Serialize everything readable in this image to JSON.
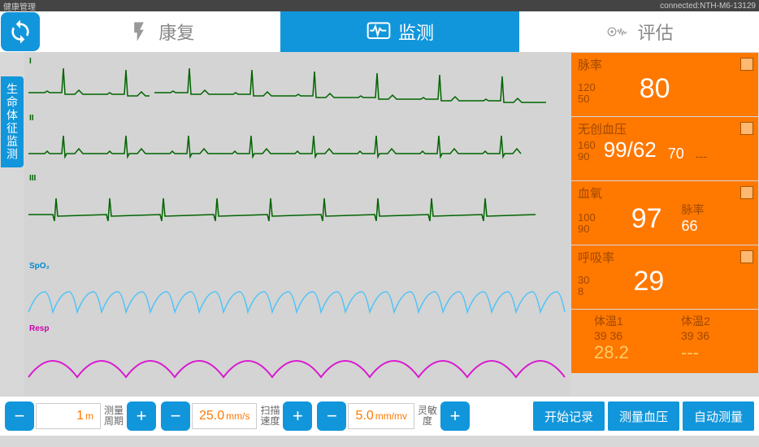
{
  "topbar": {
    "title": "健康管理",
    "status": "connected:NTH-M6-13129"
  },
  "tabs": {
    "rehab": "康复",
    "monitor": "监测",
    "assess": "评估"
  },
  "sidebar": {
    "label": "生命体征监测"
  },
  "waves": {
    "lead1": "I",
    "lead2": "II",
    "lead3": "III",
    "spo2": "SpO₂",
    "resp": "Resp"
  },
  "vitals": {
    "pulse": {
      "title": "脉率",
      "hi": "120",
      "lo": "50",
      "val": "80"
    },
    "nibp": {
      "title": "无创血压",
      "hi": "160",
      "lo": "90",
      "val": "99/62",
      "sub": "70",
      "sub2": "---"
    },
    "spo2": {
      "title": "血氧",
      "hi": "100",
      "lo": "90",
      "val": "97",
      "sublabel": "脉率",
      "subval": "66"
    },
    "resp": {
      "title": "呼吸率",
      "hi": "30",
      "lo": "8",
      "val": "29"
    },
    "temp": {
      "t1label": "体温1",
      "t1limits": "39 36",
      "t1val": "28.2",
      "t2label": "体温2",
      "t2limits": "39 36",
      "t2val": "---"
    }
  },
  "bottom": {
    "period": {
      "val": "1",
      "unit": "m",
      "label": "测量\n周期"
    },
    "scan": {
      "val": "25.0",
      "unit": "mm/s",
      "label": "扫描\n速度"
    },
    "sens": {
      "val": "5.0",
      "unit": "mm/mv",
      "label": "灵敏\n度"
    },
    "actions": {
      "record": "开始记录",
      "measure": "测量血压",
      "auto": "自动测量"
    }
  }
}
